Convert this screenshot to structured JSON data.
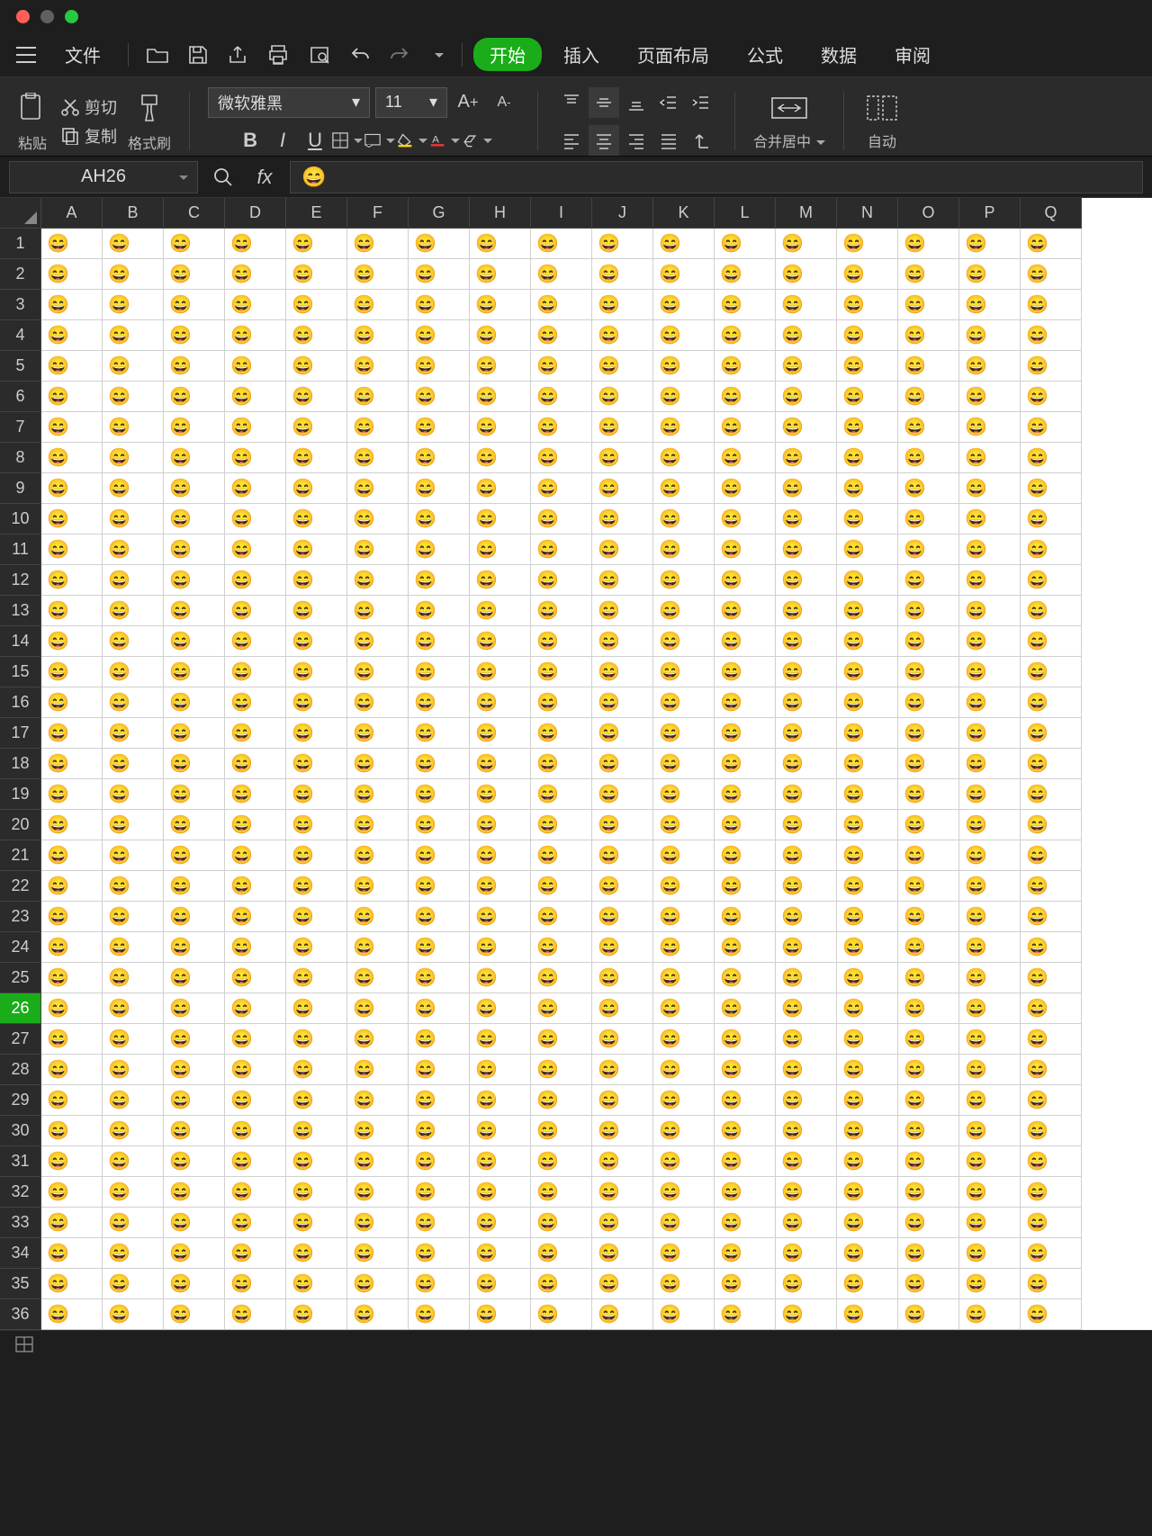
{
  "window": {
    "traffic": [
      "close",
      "min",
      "max"
    ]
  },
  "menubar": {
    "file": "文件",
    "tabs": {
      "start": "开始",
      "insert": "插入",
      "layout": "页面布局",
      "formulas": "公式",
      "data": "数据",
      "review": "审阅"
    }
  },
  "ribbon": {
    "clipboard": {
      "paste": "粘贴",
      "cut": "剪切",
      "copy": "复制",
      "format_painter": "格式刷"
    },
    "font": {
      "name": "微软雅黑",
      "size": "11",
      "increase": "A⁺",
      "decrease": "A⁻"
    },
    "merge": {
      "label": "合并居中"
    },
    "wrap": {
      "label": "自动"
    }
  },
  "namebox": {
    "ref": "AH26"
  },
  "fx": {
    "value": "😄"
  },
  "grid": {
    "columns": [
      "A",
      "B",
      "C",
      "D",
      "E",
      "F",
      "G",
      "H",
      "I",
      "J",
      "K",
      "L",
      "M",
      "N",
      "O",
      "P",
      "Q"
    ],
    "rows": 36,
    "active_row": 26,
    "cell_value": "😄"
  }
}
